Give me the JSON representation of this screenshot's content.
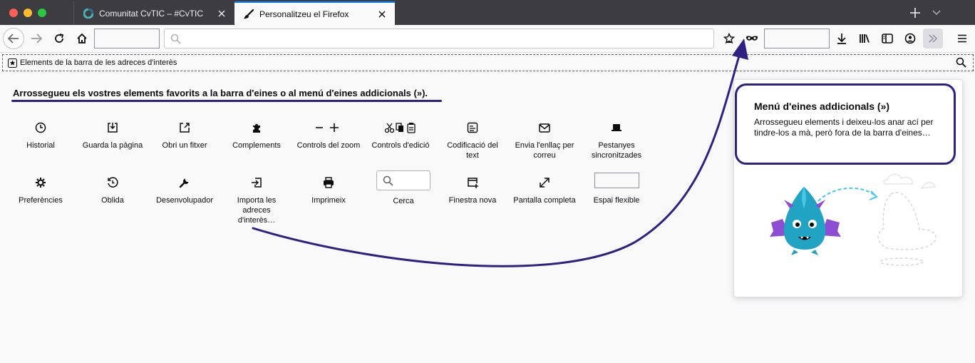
{
  "window": {
    "tabs": [
      {
        "title": "Comunitat CvTIC – #CvTIC",
        "icon": "cvtic-favicon-icon",
        "active": false
      },
      {
        "title": "Personalitzeu el Firefox",
        "icon": "paintbrush-icon",
        "active": true
      }
    ]
  },
  "bookmarks_bar": {
    "label": "Elements de la barra de les adreces d'interès"
  },
  "palette": {
    "heading": "Arrossegueu els vostres elements favorits a la barra d'eines o al menú d'eines addicionals (»).",
    "items": [
      {
        "label": "Historial",
        "icon": "clock-icon"
      },
      {
        "label": "Guarda la pàgina",
        "icon": "save-page-icon"
      },
      {
        "label": "Obri un fitxer",
        "icon": "open-file-icon"
      },
      {
        "label": "Complements",
        "icon": "puzzle-icon"
      },
      {
        "label": "Controls del zoom",
        "icon": "zoom-controls-icon"
      },
      {
        "label": "Controls d'edició",
        "icon": "edit-controls-icon"
      },
      {
        "label": "Codificació del text",
        "icon": "text-encoding-icon"
      },
      {
        "label": "Envia l'enllaç per correu",
        "icon": "mail-icon"
      },
      {
        "label": "Pestanyes sincronitzades",
        "icon": "synced-tabs-icon"
      },
      {
        "label": "Preferències",
        "icon": "gear-icon"
      },
      {
        "label": "Oblida",
        "icon": "forget-icon"
      },
      {
        "label": "Desenvolupador",
        "icon": "wrench-icon"
      },
      {
        "label": "Importa les adreces d'interès…",
        "icon": "import-icon"
      },
      {
        "label": "Imprimeix",
        "icon": "printer-icon"
      },
      {
        "label": "Cerca",
        "icon": "search-widget"
      },
      {
        "label": "Finestra nova",
        "icon": "new-window-icon"
      },
      {
        "label": "Pantalla completa",
        "icon": "fullscreen-icon"
      },
      {
        "label": "Espai flexible",
        "icon": "flexible-space"
      }
    ]
  },
  "overflow_panel": {
    "title": "Menú d'eines addicionals (»)",
    "text": "Arrossegueu elements i deixeu-los anar ací per tindre-los a mà, però fora de la barra d'eines…"
  },
  "colors": {
    "annotation": "#2f2181",
    "tabstrip": "#3d3c40",
    "accent": "#0a84ff"
  }
}
